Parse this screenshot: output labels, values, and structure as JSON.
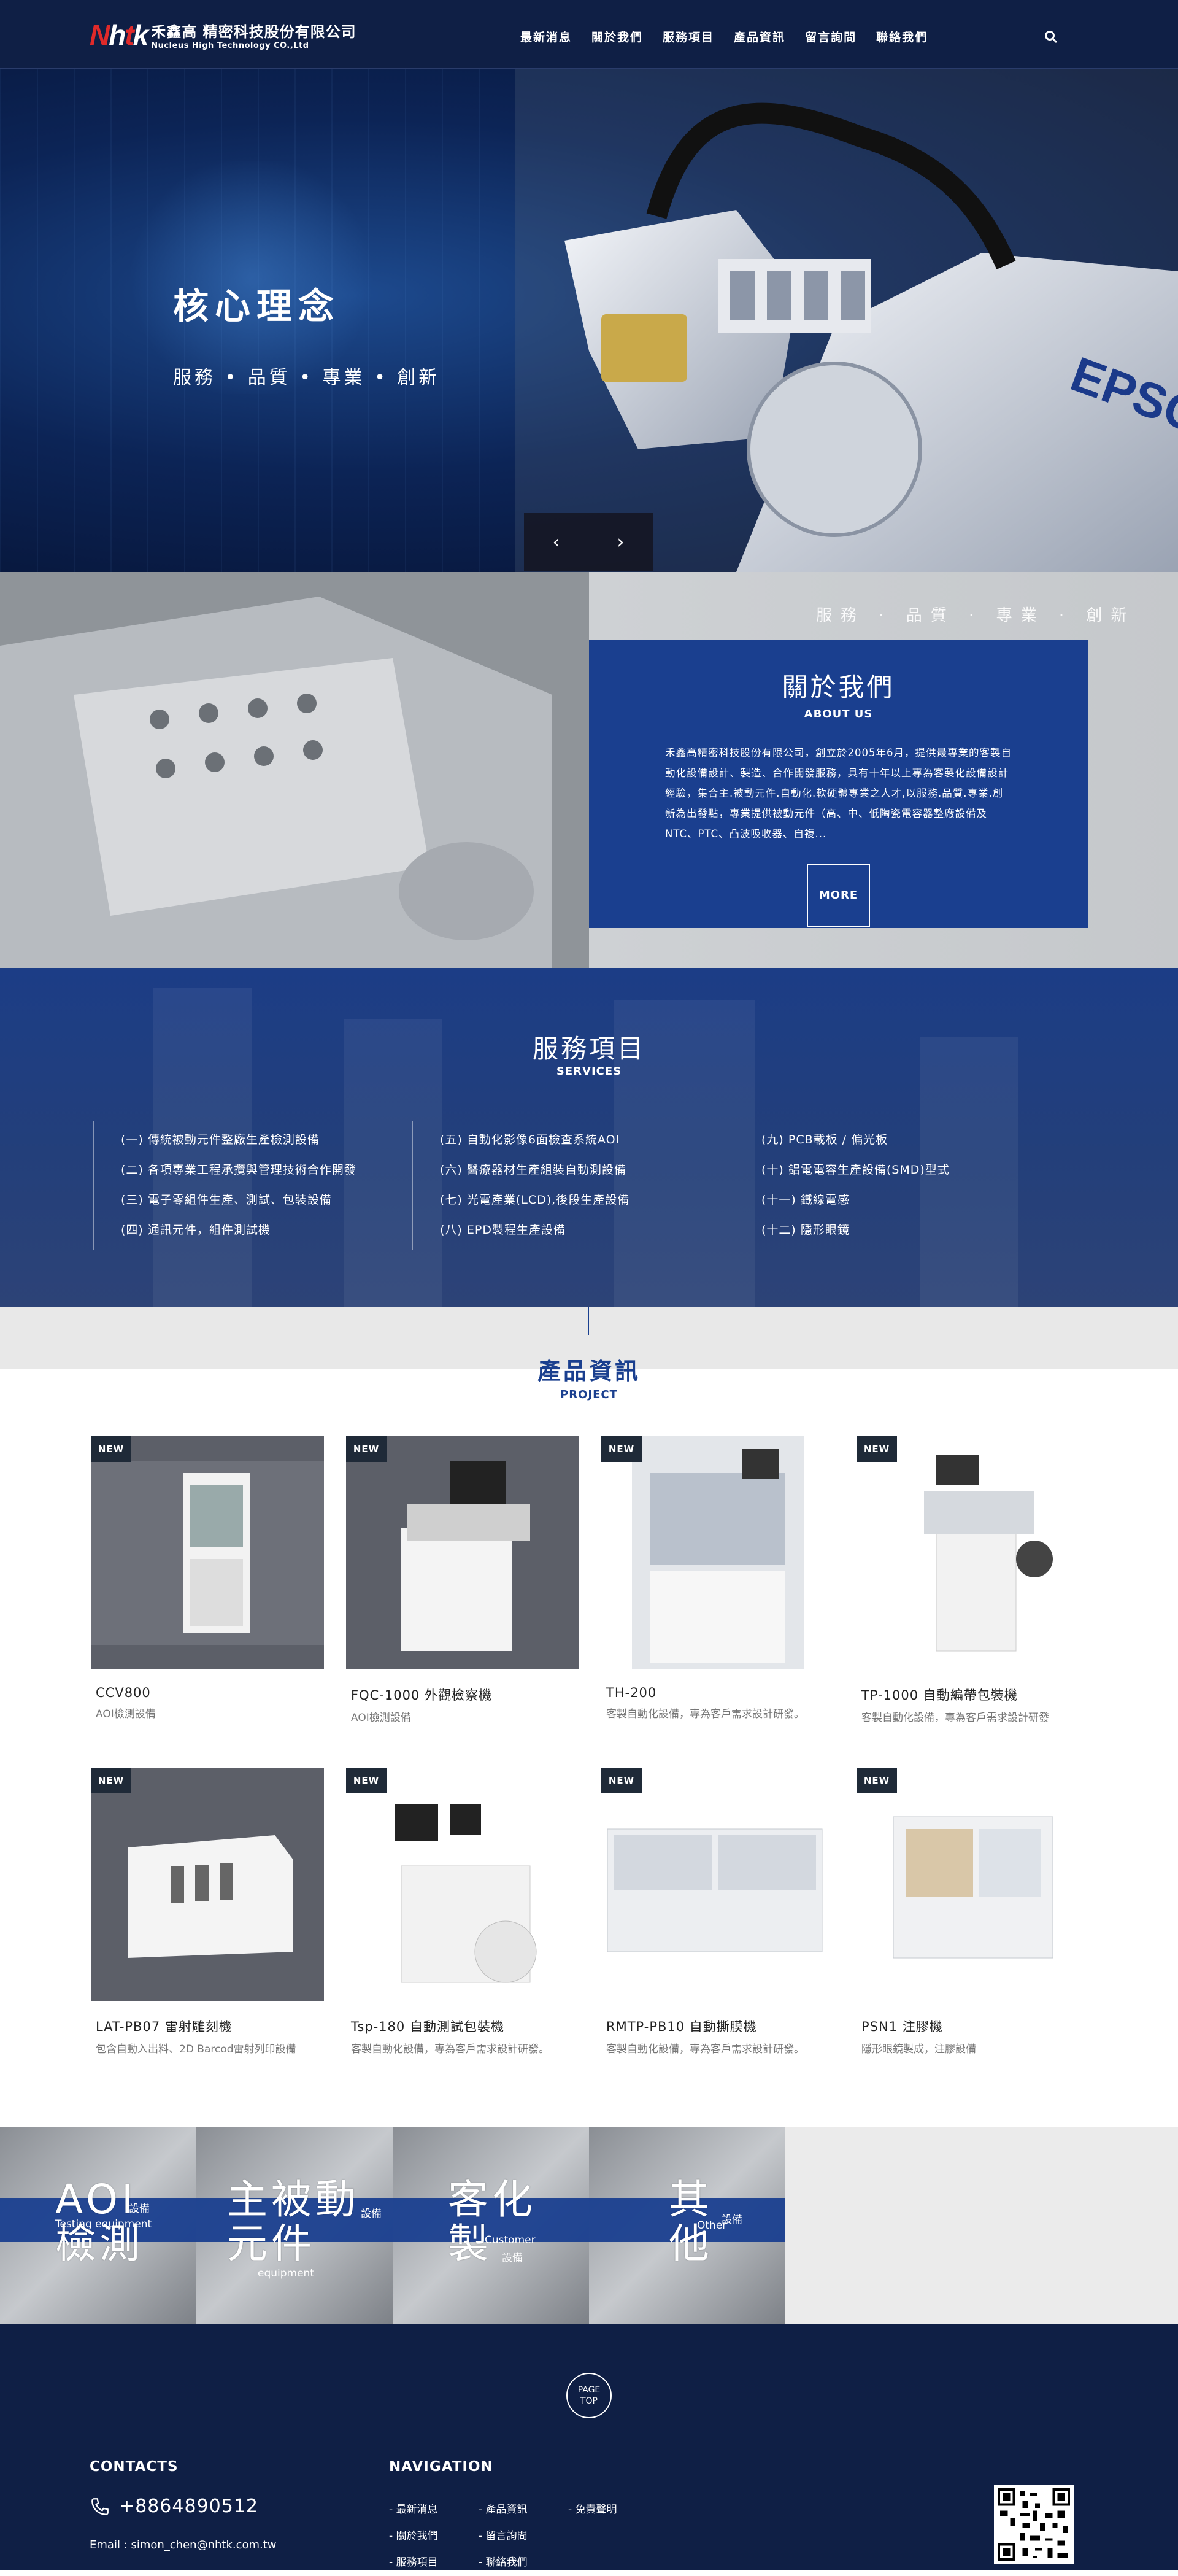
{
  "header": {
    "logo_mark": "NHtk",
    "company_cn": "禾鑫高 精密科技股份有限公司",
    "company_en": "Nucleus High Technology CO.,Ltd",
    "nav": [
      "最新消息",
      "關於我們",
      "服務項目",
      "產品資訊",
      "留言詢問",
      "聯絡我們"
    ],
    "search_placeholder": ""
  },
  "hero": {
    "title": "核心理念",
    "subtitle": "服務 • 品質 • 專業 • 創新",
    "prev": "‹",
    "next": "›"
  },
  "about": {
    "tagline": "服務 · 品質 · 專業 · 創新",
    "title": "關於我們",
    "title_en": "ABOUT US",
    "text": "禾鑫高精密科技股份有限公司，創立於2005年6月，提供最專業的客製自動化設備設計、製造、合作開發服務，具有十年以上專為客製化設備設計經驗，集合主.被動元件.自動化.軟硬體專業之人才,以服務.品質.專業.創新為出發點，專業提供被動元件（高、中、低陶瓷電容器整廠設備及NTC、PTC、凸波吸收器、自複...",
    "more": "MORE"
  },
  "services": {
    "title": "服務項目",
    "title_en": "SERVICES",
    "col1": [
      "(一) 傳統被動元件整廠生產檢測設備",
      "(二) 各項專業工程承攬與管理技術合作開發",
      "(三) 電子零組件生產、測試、包裝設備",
      "(四) 通訊元件，組件測試機"
    ],
    "col2": [
      "(五) 自動化影像6面檢查系統AOI",
      "(六) 醫療器材生產組裝自動測設備",
      "(七) 光電產業(LCD),後段生產設備",
      "(八) EPD製程生產設備"
    ],
    "col3": [
      "(九) PCB載板 / 偏光板",
      "(十) 鋁電電容生產設備(SMD)型式",
      "(十一) 鐵線電感",
      "(十二) 隱形眼鏡"
    ]
  },
  "products": {
    "title": "產品資訊",
    "title_en": "PROJECT",
    "badge": "NEW",
    "items": [
      {
        "name": "CCV800",
        "desc": "AOI檢測設備"
      },
      {
        "name": "FQC-1000 外觀檢察機",
        "desc": "AOI檢測設備"
      },
      {
        "name": "TH-200",
        "desc": "客製自動化設備，專為客戶需求設計研發。"
      },
      {
        "name": "TP-1000 自動編帶包裝機",
        "desc": "客製自動化設備，專為客戶需求設計研發"
      },
      {
        "name": "LAT-PB07 雷射雕刻機",
        "desc": "包含自動入出料、2D Barcod雷射列印設備"
      },
      {
        "name": "Tsp-180 自動測試包裝機",
        "desc": "客製自動化設備，專為客戶需求設計研發。"
      },
      {
        "name": "RMTP-PB10 自動撕膜機",
        "desc": "客製自動化設備，專為客戶需求設計研發。"
      },
      {
        "name": "PSN1 注膠機",
        "desc": "隱形眼鏡製成，注膠設備"
      }
    ]
  },
  "categories": [
    {
      "big1": "AOI",
      "big2": "檢測",
      "small1": "設備",
      "small2": "Testing equipment"
    },
    {
      "big1": "主被動",
      "big2": "元件",
      "small1": "設備",
      "small2": "equipment"
    },
    {
      "big1": "客化",
      "big2": "製",
      "small1": "Customer",
      "small2": "設備"
    },
    {
      "big1": "其",
      "big2": "他",
      "small1": "設備",
      "small2": "Other"
    }
  ],
  "footer": {
    "pagetop1": "PAGE",
    "pagetop2": "TOP",
    "contacts_title": "CONTACTS",
    "phone": "+8864890512",
    "email": "Email : simon_chen@nhtk.com.tw",
    "nav_title": "NAVIGATION",
    "nav_col1": [
      "- 最新消息",
      "- 關於我們",
      "- 服務項目"
    ],
    "nav_col2": [
      "- 產品資訊",
      "- 留言詢問",
      "- 聯絡我們"
    ],
    "nav_col3": [
      "- 免責聲明"
    ]
  },
  "colors": {
    "brand_navy": "#0f1f45",
    "brand_blue": "#1a3f8f",
    "badge": "#1f2a38"
  }
}
